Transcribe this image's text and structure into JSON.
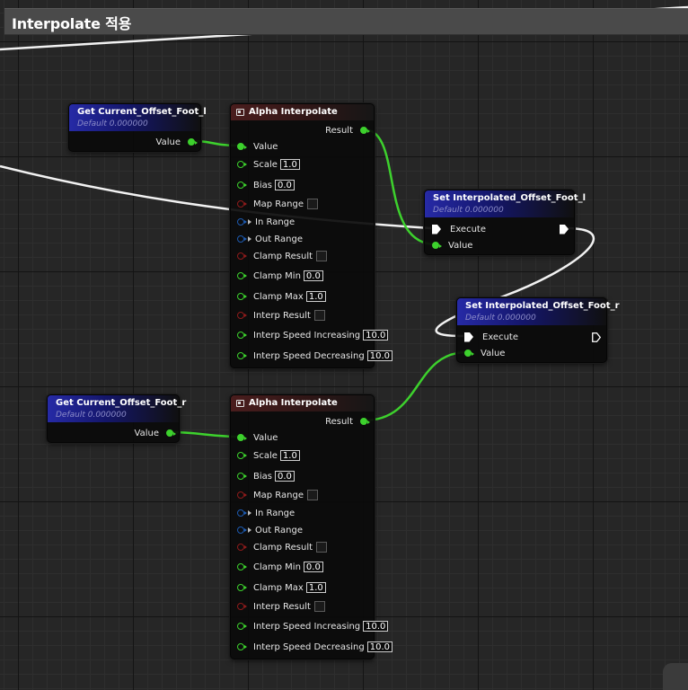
{
  "comment": {
    "title": "Interpolate 적용"
  },
  "get_left": {
    "title": "Get Current_Offset_Foot_l",
    "subtitle": "Default 0.000000",
    "out_label": "Value"
  },
  "get_right": {
    "title": "Get Current_Offset_Foot_r",
    "subtitle": "Default 0.000000",
    "out_label": "Value"
  },
  "alpha_top": {
    "title": "Alpha Interpolate",
    "result_label": "Result",
    "pins": {
      "value": "Value",
      "scale": "Scale",
      "scale_val": "1.0",
      "bias": "Bias",
      "bias_val": "0.0",
      "map_range": "Map Range",
      "in_range": "In Range",
      "out_range": "Out Range",
      "clamp_result": "Clamp Result",
      "clamp_min": "Clamp Min",
      "clamp_min_val": "0.0",
      "clamp_max": "Clamp Max",
      "clamp_max_val": "1.0",
      "interp_result": "Interp Result",
      "speed_inc": "Interp Speed Increasing",
      "speed_inc_val": "10.0",
      "speed_dec": "Interp Speed Decreasing",
      "speed_dec_val": "10.0"
    }
  },
  "alpha_bottom": {
    "title": "Alpha Interpolate",
    "result_label": "Result",
    "pins": {
      "value": "Value",
      "scale": "Scale",
      "scale_val": "1.0",
      "bias": "Bias",
      "bias_val": "0.0",
      "map_range": "Map Range",
      "in_range": "In Range",
      "out_range": "Out Range",
      "clamp_result": "Clamp Result",
      "clamp_min": "Clamp Min",
      "clamp_min_val": "0.0",
      "clamp_max": "Clamp Max",
      "clamp_max_val": "1.0",
      "interp_result": "Interp Result",
      "speed_inc": "Interp Speed Increasing",
      "speed_inc_val": "10.0",
      "speed_dec": "Interp Speed Decreasing",
      "speed_dec_val": "10.0"
    }
  },
  "set_left": {
    "title": "Set Interpolated_Offset_Foot_l",
    "subtitle": "Default 0.000000",
    "exec_label": "Execute",
    "value_label": "Value"
  },
  "set_right": {
    "title": "Set Interpolated_Offset_Foot_r",
    "subtitle": "Default 0.000000",
    "exec_label": "Execute",
    "value_label": "Value"
  },
  "colors": {
    "float_wire": "#3dd12d",
    "exec_wire": "#ffffff",
    "var_header": "#262aa6",
    "pure_header": "#4a1d1d"
  }
}
